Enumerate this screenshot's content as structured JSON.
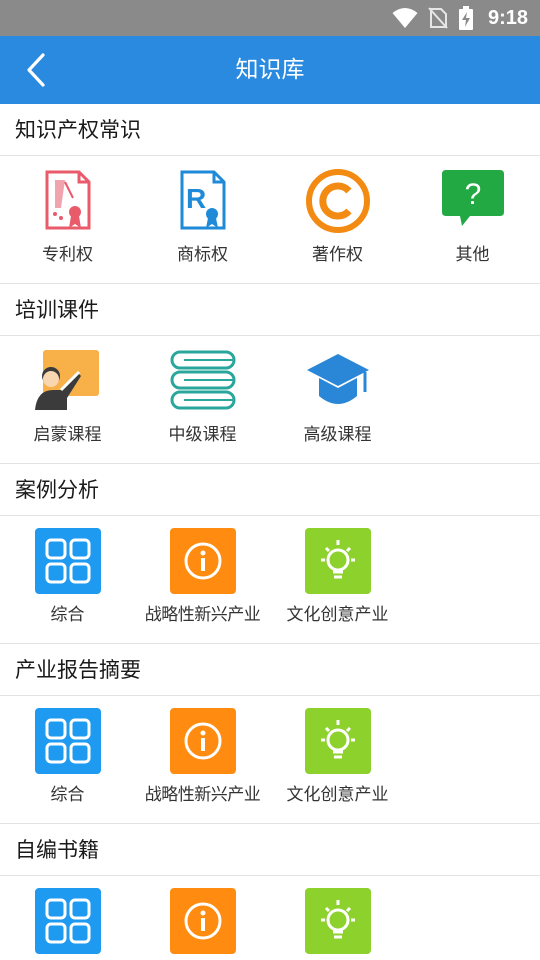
{
  "status_bar": {
    "time": "9:18",
    "icons": [
      "wifi-icon",
      "no-sim-icon",
      "battery-charging-icon"
    ]
  },
  "app_bar": {
    "title": "知识库",
    "back_icon": "back-arrow-icon"
  },
  "sections": [
    {
      "title": "知识产权常识",
      "items": [
        {
          "label": "专利权",
          "icon": "patent-certificate-icon",
          "color": "#e95a6b"
        },
        {
          "label": "商标权",
          "icon": "trademark-r-icon",
          "color": "#1e8ad8"
        },
        {
          "label": "著作权",
          "icon": "copyright-icon",
          "color": "#f38a12"
        },
        {
          "label": "其他",
          "icon": "question-chat-icon",
          "color": "#23a943"
        }
      ]
    },
    {
      "title": "培训课件",
      "items": [
        {
          "label": "启蒙课程",
          "icon": "teacher-board-icon",
          "color": "#f8b049"
        },
        {
          "label": "中级课程",
          "icon": "books-stack-icon",
          "color": "#2aa79c"
        },
        {
          "label": "高级课程",
          "icon": "graduation-cap-icon",
          "color": "#2a86d6"
        }
      ]
    },
    {
      "title": "案例分析",
      "items": [
        {
          "label": "综合",
          "icon": "grid-four-icon",
          "color": "#1e9bf0"
        },
        {
          "label": "战略性新兴产业",
          "icon": "info-circle-icon",
          "color": "#ff8c10"
        },
        {
          "label": "文化创意产业",
          "icon": "lightbulb-icon",
          "color": "#8dd12c"
        }
      ]
    },
    {
      "title": "产业报告摘要",
      "items": [
        {
          "label": "综合",
          "icon": "grid-four-icon",
          "color": "#1e9bf0"
        },
        {
          "label": "战略性新兴产业",
          "icon": "info-circle-icon",
          "color": "#ff8c10"
        },
        {
          "label": "文化创意产业",
          "icon": "lightbulb-icon",
          "color": "#8dd12c"
        }
      ]
    },
    {
      "title": "自编书籍",
      "items": [
        {
          "label": "",
          "icon": "grid-four-icon",
          "color": "#1e9bf0"
        },
        {
          "label": "",
          "icon": "info-circle-icon",
          "color": "#ff8c10"
        },
        {
          "label": "",
          "icon": "lightbulb-icon",
          "color": "#8dd12c"
        }
      ]
    }
  ],
  "colors": {
    "app_bar": "#2a8ae0",
    "status_bar": "#8a8a8a"
  }
}
